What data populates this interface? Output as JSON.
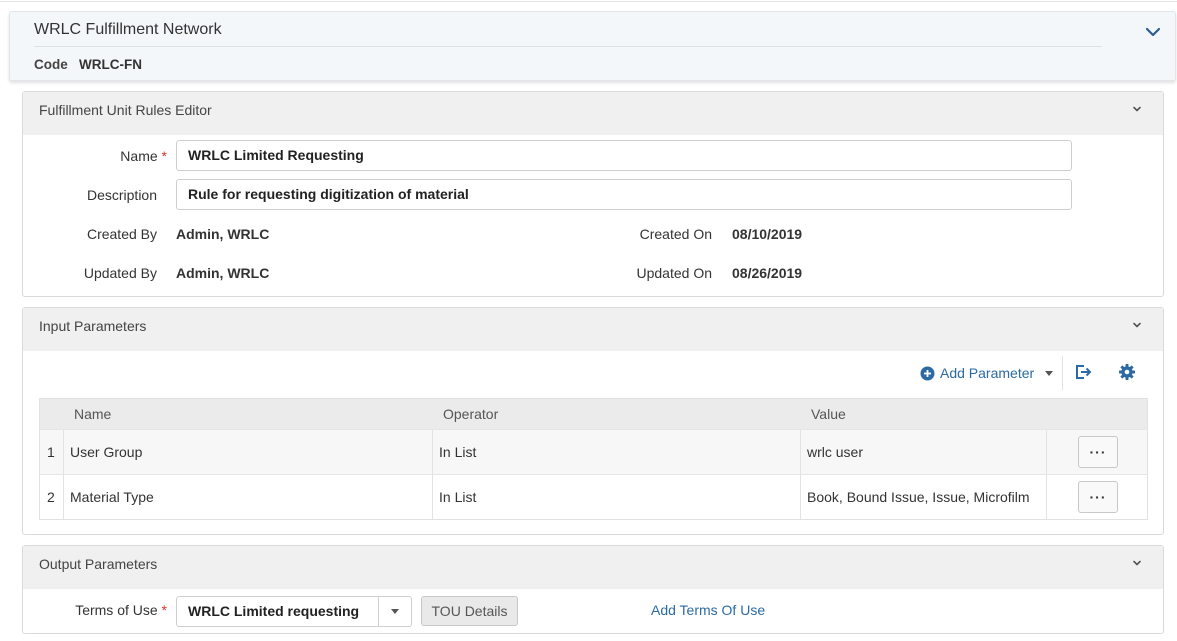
{
  "header": {
    "title": "WRLC Fulfillment Network",
    "code_label": "Code",
    "code_value": "WRLC-FN"
  },
  "rules_editor": {
    "title": "Fulfillment Unit Rules Editor",
    "name_label": "Name",
    "required_mark": "*",
    "name_value": "WRLC Limited Requesting",
    "description_label": "Description",
    "description_value": "Rule for requesting digitization of material",
    "created_by_label": "Created By",
    "created_by_value": "Admin, WRLC",
    "created_on_label": "Created On",
    "created_on_value": "08/10/2019",
    "updated_by_label": "Updated By",
    "updated_by_value": "Admin, WRLC",
    "updated_on_label": "Updated On",
    "updated_on_value": "08/26/2019"
  },
  "input_parameters": {
    "title": "Input Parameters",
    "add_parameter_label": "Add Parameter",
    "columns": [
      "Name",
      "Operator",
      "Value"
    ],
    "rows": [
      {
        "index": "1",
        "name": "User Group",
        "operator": "In List",
        "value": "wrlc user",
        "actions": "···"
      },
      {
        "index": "2",
        "name": "Material Type",
        "operator": "In List",
        "value": "Book, Bound Issue, Issue, Microfilm",
        "actions": "···"
      }
    ]
  },
  "output_parameters": {
    "title": "Output Parameters",
    "terms_label": "Terms of Use",
    "required_mark": "*",
    "terms_value": "WRLC Limited requesting",
    "tou_details_label": "TOU Details",
    "add_terms_label": "Add Terms Of Use"
  },
  "colors": {
    "link": "#2b6aa3",
    "required": "#d9342b",
    "panel_header_bg": "#f0f0f0",
    "header_card_bg": "#f4f7f9"
  },
  "icons": {
    "header_toggle": "chevron-down-icon",
    "add_parameter": "plus-circle-icon",
    "export": "export-icon",
    "settings": "gear-icon"
  }
}
